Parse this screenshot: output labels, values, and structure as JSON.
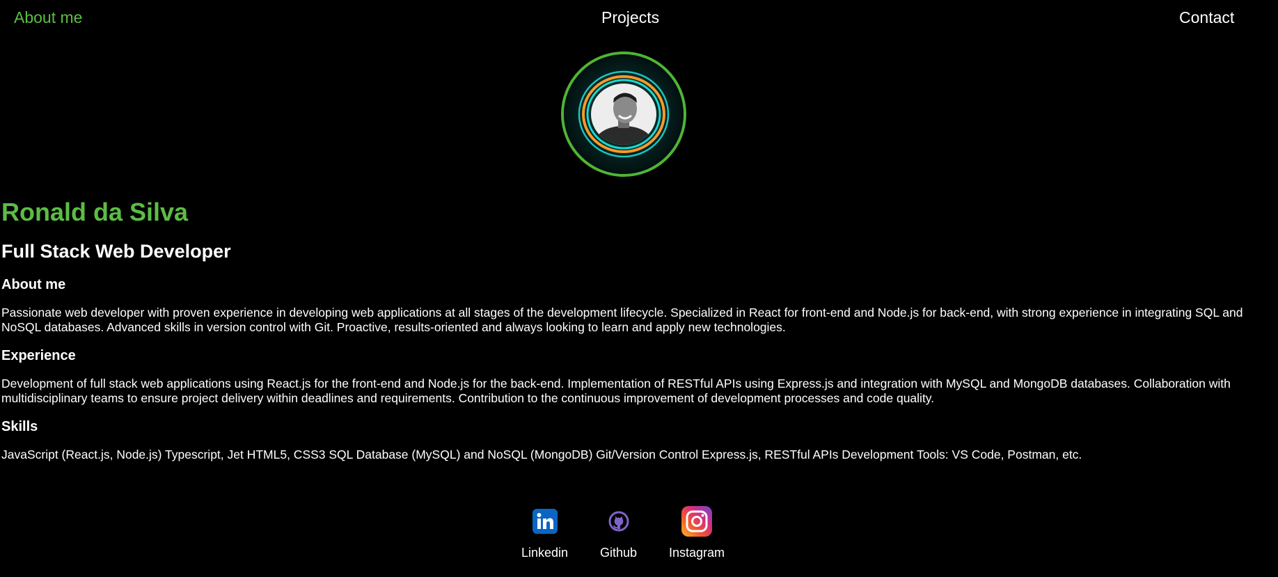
{
  "nav": {
    "about": "About me",
    "projects": "Projects",
    "contact": "Contact"
  },
  "profile": {
    "name": "Ronald da Silva",
    "role": "Full Stack Web Developer"
  },
  "sections": {
    "about": {
      "title": "About me",
      "text": "Passionate web developer with proven experience in developing web applications at all stages of the development lifecycle. Specialized in React for front-end and Node.js for back-end, with strong experience in integrating SQL and NoSQL databases. Advanced skills in version control with Git. Proactive, results-oriented and always looking to learn and apply new technologies."
    },
    "experience": {
      "title": "Experience",
      "text": "Development of full stack web applications using React.js for the front-end and Node.js for the back-end. Implementation of RESTful APIs using Express.js and integration with MySQL and MongoDB databases. Collaboration with multidisciplinary teams to ensure project delivery within deadlines and requirements. Contribution to the continuous improvement of development processes and code quality."
    },
    "skills": {
      "title": "Skills",
      "text": "JavaScript (React.js, Node.js) Typescript, Jet HTML5, CSS3 SQL Database (MySQL) and NoSQL (MongoDB) Git/Version Control Express.js, RESTful APIs Development Tools: VS Code, Postman, etc."
    }
  },
  "social": {
    "linkedin": "Linkedin",
    "github": "Github",
    "instagram": "Instagram"
  },
  "colors": {
    "accent": "#5cbd45",
    "background": "#000000",
    "text": "#ffffff"
  },
  "icons": {
    "linkedin": "linkedin-icon",
    "github": "github-icon",
    "instagram": "instagram-icon"
  }
}
